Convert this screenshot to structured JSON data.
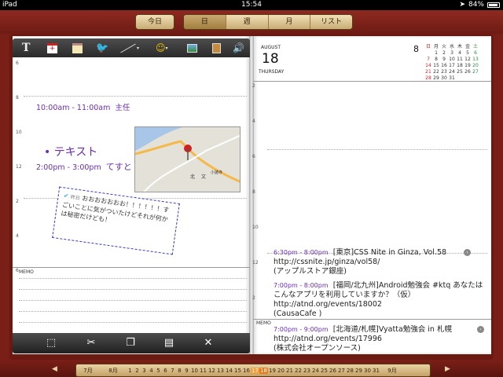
{
  "status": {
    "device": "iPad",
    "time": "15:54",
    "battery": "84%"
  },
  "nav": {
    "today": "今日",
    "views": [
      "日",
      "週",
      "月",
      "リスト"
    ],
    "active_view": "日"
  },
  "editor_tools": [
    "text-tool",
    "insert-event-tool",
    "calendar-tool",
    "twitter-tool",
    "pen-tool",
    "emoji-tool",
    "image-tool",
    "contact-tool",
    "audio-tool"
  ],
  "left_page": {
    "hours": [
      "6",
      "",
      "8",
      "",
      "10",
      "",
      "12",
      "",
      "2",
      "",
      "4",
      "",
      "6"
    ],
    "events": [
      {
        "time": "10:00am - 11:00am",
        "title": "主任"
      },
      {
        "bullet": "•",
        "text": "テキスト"
      },
      {
        "time": "2:00pm - 3:00pm",
        "title": "てすと"
      }
    ],
    "note": {
      "label": "昨日",
      "text": "おおおおおおお！！！！！！すごいことに気がついたけどそれが何かは秘密だけども！"
    },
    "map_labels": [
      "小諸寺",
      "北",
      "文"
    ],
    "memo_label": "MEMO"
  },
  "right_page": {
    "month": "AUGUST",
    "day": "18",
    "weekday": "THURSDAY",
    "mini_month": "8",
    "mini_header": [
      "日",
      "月",
      "火",
      "水",
      "木",
      "金",
      "土"
    ],
    "mini_rows": [
      [
        "",
        "1",
        "2",
        "3",
        "4",
        "5",
        "6"
      ],
      [
        "7",
        "8",
        "9",
        "10",
        "11",
        "12",
        "13"
      ],
      [
        "14",
        "15",
        "16",
        "17",
        "18",
        "19",
        "20"
      ],
      [
        "21",
        "22",
        "23",
        "24",
        "25",
        "26",
        "27"
      ],
      [
        "28",
        "29",
        "30",
        "31",
        "",
        "",
        ""
      ]
    ],
    "hours": [
      "2",
      "",
      "4",
      "",
      "6",
      "",
      "8",
      "",
      "10",
      "",
      "12",
      "",
      "2"
    ],
    "events": [
      {
        "time": "6:30pm - 8:00pm",
        "title": "[東京]CSS Nite in Ginza, Vol.58",
        "url": "http://cssnite.jp/ginza/vol58/",
        "place": "(アップルストア銀座)"
      },
      {
        "time": "7:00pm - 8:00pm",
        "title": "[福岡/北九州]Android勉強会 #ktq あなたはこんなアプリを利用していますか？（仮）",
        "url": "http://atnd.org/events/18002",
        "place": "(CausaCafe )"
      },
      {
        "time": "7:00pm - 9:00pm",
        "title": "[北海道/札幌]Vyatta勉強会 in 札幌",
        "url": "http://atnd.org/events/17996",
        "place": "(株式会社オープンソース)"
      }
    ],
    "memo_label": "MEMO"
  },
  "date_strip": {
    "prev_month": "7月",
    "month": "8月",
    "days": [
      "1",
      "2",
      "3",
      "4",
      "5",
      "6",
      "7",
      "8",
      "9",
      "10",
      "11",
      "12",
      "13",
      "14",
      "15",
      "16",
      "17",
      "18",
      "19",
      "20",
      "21",
      "22",
      "23",
      "24",
      "25",
      "26",
      "27",
      "28",
      "29",
      "30",
      "31"
    ],
    "next_month": "9月",
    "selected": "18",
    "today": "17"
  }
}
